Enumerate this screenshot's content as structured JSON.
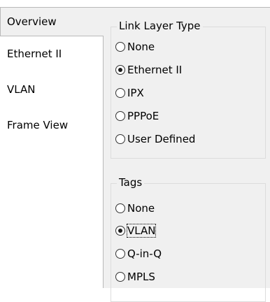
{
  "tabs": [
    {
      "label": "Overview",
      "active": true
    },
    {
      "label": "Ethernet II",
      "active": false
    },
    {
      "label": "VLAN",
      "active": false
    },
    {
      "label": "Frame View",
      "active": false
    }
  ],
  "link_layer_group": {
    "title": "Link Layer Type",
    "options": [
      {
        "label": "None",
        "checked": false
      },
      {
        "label": "Ethernet II",
        "checked": true
      },
      {
        "label": "IPX",
        "checked": false
      },
      {
        "label": "PPPoE",
        "checked": false
      },
      {
        "label": "User Defined",
        "checked": false
      }
    ]
  },
  "tags_group": {
    "title": "Tags",
    "options": [
      {
        "label": "None",
        "checked": false
      },
      {
        "label": "VLAN",
        "checked": true,
        "focused": true
      },
      {
        "label": "Q-in-Q",
        "checked": false
      },
      {
        "label": "MPLS",
        "checked": false
      }
    ]
  }
}
